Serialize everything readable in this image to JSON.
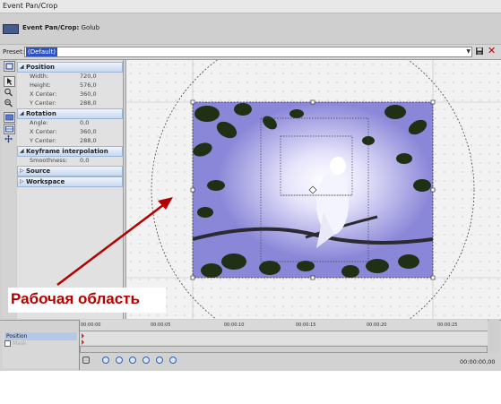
{
  "window": {
    "title": "Event Pan/Crop"
  },
  "event": {
    "label": "Event Pan/Crop:",
    "name": "Golub"
  },
  "preset": {
    "label": "Preset:",
    "value": "(Default)"
  },
  "tools": [
    "normal-edit-tool",
    "pointer-tool",
    "zoom-tool",
    "zoom-out-tool",
    "rotate-tool",
    "snap-tool",
    "move-tool"
  ],
  "properties": {
    "position": {
      "title": "Position",
      "rows": [
        {
          "name": "Width:",
          "value": "720,0"
        },
        {
          "name": "Height:",
          "value": "576,0"
        },
        {
          "name": "X Center:",
          "value": "360,0"
        },
        {
          "name": "Y Center:",
          "value": "288,0"
        }
      ]
    },
    "rotation": {
      "title": "Rotation",
      "rows": [
        {
          "name": "Angle:",
          "value": "0,0"
        },
        {
          "name": "X Center:",
          "value": "360,0"
        },
        {
          "name": "Y Center:",
          "value": "288,0"
        }
      ]
    },
    "keyframe": {
      "title": "Keyframe interpolation",
      "rows": [
        {
          "name": "Smoothness:",
          "value": "0,0"
        }
      ]
    },
    "source": {
      "title": "Source"
    },
    "workspace": {
      "title": "Workspace"
    }
  },
  "timeline": {
    "track_position": "Position",
    "track_mask": "Mask",
    "ticks": [
      "00:00:00",
      "00:00:05",
      "00:00:10",
      "00:00:15",
      "00:00:20",
      "00:00:25"
    ],
    "timecode": "00:00:00,00"
  },
  "annotation": {
    "text": "Рабочая область",
    "color": "#b30000"
  },
  "colors": {
    "selection": "#2b53c6",
    "section_header": "#c6d8f0",
    "photo_sky": "#8a86d8"
  }
}
